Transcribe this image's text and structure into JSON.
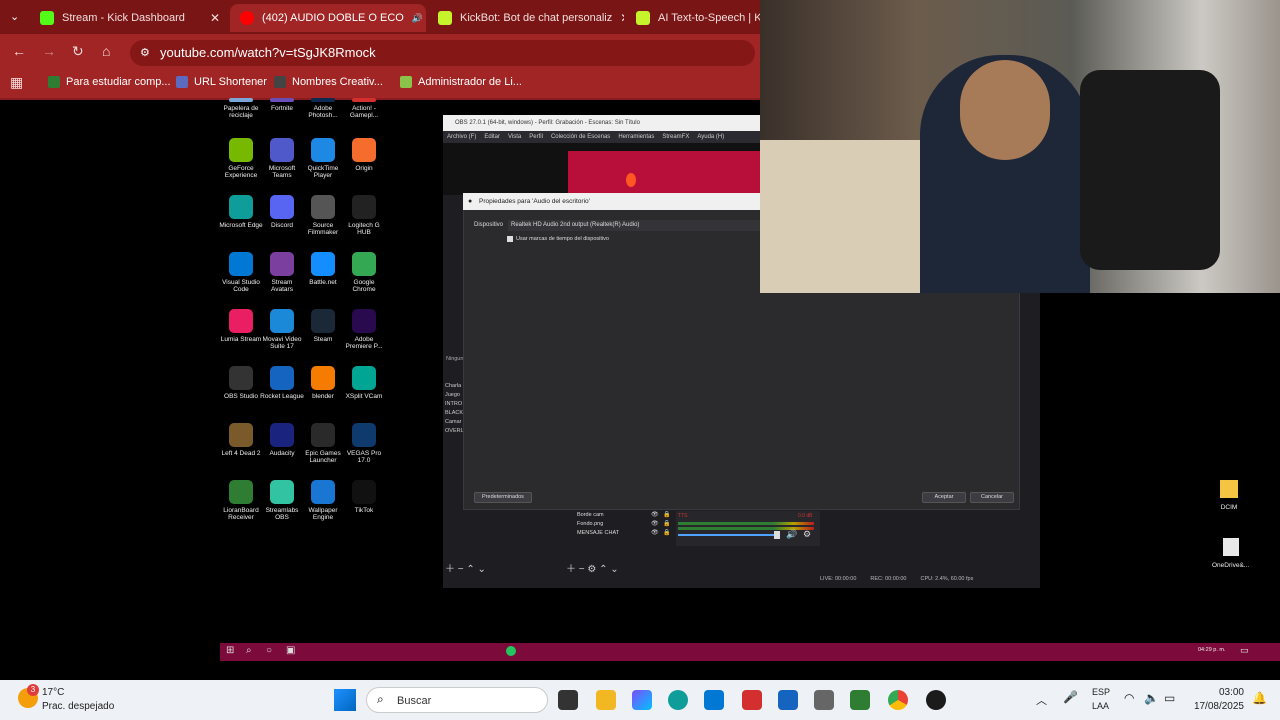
{
  "browser": {
    "tabs": [
      {
        "title": "Stream - Kick Dashboard",
        "color": "#53fc18"
      },
      {
        "title": "(402) AUDIO DOBLE O ECO",
        "color": "#ff0000"
      },
      {
        "title": "KickBot: Bot de chat personaliz",
        "color": "#c6f32b"
      },
      {
        "title": "AI Text-to-Speech | Kick",
        "color": "#c6f32b"
      }
    ],
    "url": "youtube.com/watch?v=tSgJK8Rmock",
    "bookmarks": [
      {
        "label": "Para estudiar comp...",
        "color": "#2e7d32"
      },
      {
        "label": "URL Shortener",
        "color": "#5c6bc0"
      },
      {
        "label": "Nombres Creativ...",
        "color": "#444444"
      },
      {
        "label": "Administrador de Li...",
        "color": "#8bc34a"
      }
    ]
  },
  "desktop": {
    "icons": [
      {
        "label": "Papelera de reciclaje",
        "color": "#7aa7d8"
      },
      {
        "label": "Fortnite",
        "color": "#6a4fb6"
      },
      {
        "label": "Adobe Photosh...",
        "color": "#0d2a52"
      },
      {
        "label": "Action! - Gamepl...",
        "color": "#d32f2f"
      },
      {
        "label": "GeForce Experience",
        "color": "#76b900"
      },
      {
        "label": "Microsoft Teams",
        "color": "#5059c9"
      },
      {
        "label": "QuickTime Player",
        "color": "#1e88e5"
      },
      {
        "label": "Origin",
        "color": "#f56c2d"
      },
      {
        "label": "Microsoft Edge",
        "color": "#0f9d9a"
      },
      {
        "label": "Discord",
        "color": "#5865f2"
      },
      {
        "label": "Source Filmmaker",
        "color": "#555555"
      },
      {
        "label": "Logitech G HUB",
        "color": "#222222"
      },
      {
        "label": "Visual Studio Code",
        "color": "#0078d4"
      },
      {
        "label": "Stream Avatars",
        "color": "#7b3fa0"
      },
      {
        "label": "Battle.net",
        "color": "#148eff"
      },
      {
        "label": "Google Chrome",
        "color": "#34a853"
      },
      {
        "label": "Lumia Stream",
        "color": "#e91e63"
      },
      {
        "label": "Movavi Video Suite 17",
        "color": "#1b88d8"
      },
      {
        "label": "Steam",
        "color": "#1b2838"
      },
      {
        "label": "Adobe Premiere P...",
        "color": "#2a0a4e"
      },
      {
        "label": "OBS Studio",
        "color": "#333333"
      },
      {
        "label": "Rocket League",
        "color": "#1565c0"
      },
      {
        "label": "blender",
        "color": "#f57c00"
      },
      {
        "label": "XSplit VCam",
        "color": "#00a693"
      },
      {
        "label": "Left 4 Dead 2",
        "color": "#7a5a2a"
      },
      {
        "label": "Audacity",
        "color": "#1a237e"
      },
      {
        "label": "Epic Games Launcher",
        "color": "#2a2a2a"
      },
      {
        "label": "VEGAS Pro 17.0",
        "color": "#0e3a6e"
      },
      {
        "label": "LioranBoard Receiver",
        "color": "#2e7d32"
      },
      {
        "label": "Streamlabs OBS",
        "color": "#31c3a2"
      },
      {
        "label": "Wallpaper Engine",
        "color": "#1976d2"
      },
      {
        "label": "TikTok",
        "color": "#111111"
      }
    ],
    "right_icons": [
      {
        "label": "DCIM",
        "color": "#f4c542"
      },
      {
        "label": "OneDrive&...",
        "color": "#e8e8e8"
      }
    ]
  },
  "obs": {
    "title": "OBS 27.0.1 (64-bit, windows) - Perfil: Grabación - Escenas: Sin Título",
    "menu": [
      "Archivo (F)",
      "Editar",
      "Vista",
      "Perfil",
      "Colección de Escenas",
      "Herramientas",
      "StreamFX",
      "Ayuda (H)"
    ],
    "properties_title": "Propiedades para 'Audio del escritorio'",
    "device_label": "Dispositivo",
    "device_value": "Realtek HD Audio 2nd output (Realtek(R) Audio)",
    "checkbox_label": "Usar marcas de tiempo del dispositivo",
    "defaults_btn": "Predeterminados",
    "accept_btn": "Aceptar",
    "cancel_btn": "Cancelar",
    "scene_none": "Ningun",
    "scenes": [
      "Charla",
      "Juego",
      "INTRO",
      "BLACK",
      "Camar",
      "OVERL"
    ],
    "sources": [
      "Borde cam",
      "Fondo.png",
      "MENSAJE CHAT"
    ],
    "mixer_name": "TTS",
    "mixer_db": "0.0 dB",
    "status": {
      "live": "LIVE: 00:00:00",
      "rec": "REC: 00:00:00",
      "cpu": "CPU: 2.4%, 60.00 fps"
    }
  },
  "taskbar": {
    "weather_temp": "17°C",
    "weather_desc": "Prac. despejado",
    "weather_badge": "3",
    "search": "Buscar",
    "lang": "ESP",
    "lang2": "LAA",
    "time": "03:00",
    "date": "17/08/2025",
    "inner_clock": "04:29 p. m."
  }
}
